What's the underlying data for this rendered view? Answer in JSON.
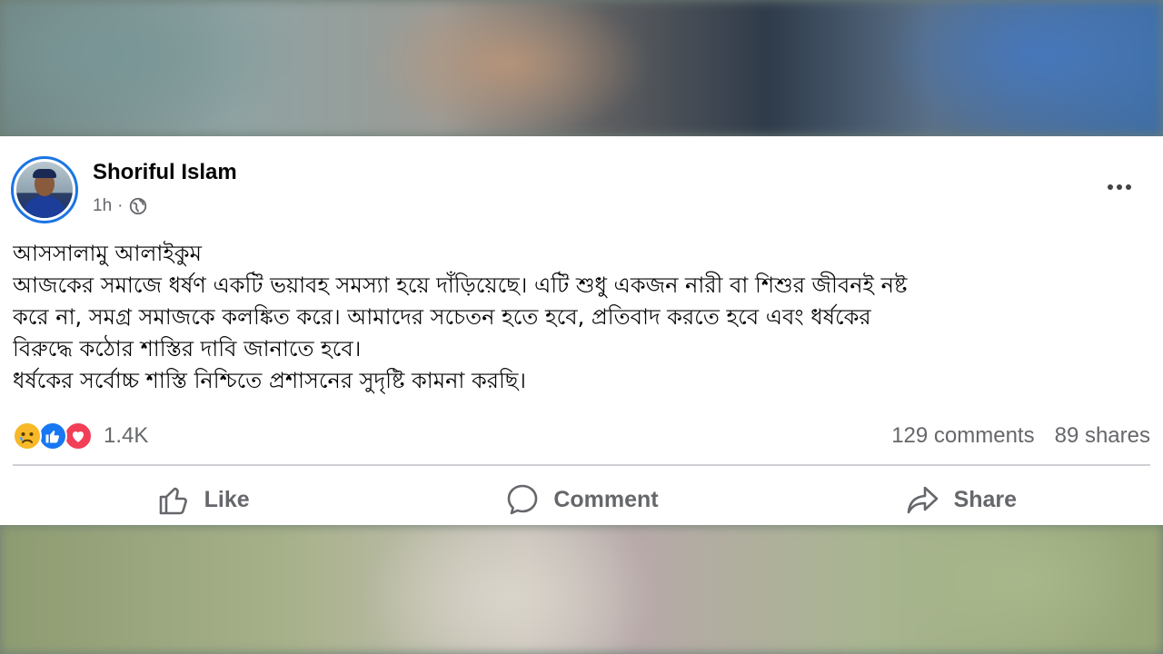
{
  "post": {
    "author": "Shoriful Islam",
    "time": "1h",
    "more_icon": "more-horizontal-icon",
    "privacy_icon": "globe-icon",
    "lines": [
      "আসসালামু আলাইকুম",
      "আজকের সমাজে ধর্ষণ একটি ভয়াবহ সমস্যা হয়ে দাঁড়িয়েছে। এটি শুধু একজন নারী বা শিশুর জীবনই নষ্ট",
      "করে না, সমগ্র সমাজকে কলঙ্কিত করে। আমাদের সচেতন হতে হবে, প্রতিবাদ করতে হবে এবং ধর্ষকের",
      "বিরুদ্ধে কঠোর শাস্তির দাবি জানাতে হবে।",
      "ধর্ষকের সর্বোচ্চ শাস্তি নিশ্চিতে প্রশাসনের সুদৃষ্টি   কামনা করছি।"
    ]
  },
  "reactions": {
    "icons": [
      "sad-reaction-icon",
      "like-reaction-icon",
      "love-reaction-icon"
    ],
    "count": "1.4K"
  },
  "stats": {
    "comments": "129 comments",
    "shares": "89 shares"
  },
  "actions": {
    "like": "Like",
    "comment": "Comment",
    "share": "Share"
  },
  "colors": {
    "accent": "#1b74e4",
    "text_secondary": "#65676b",
    "like_blue": "#1877f2",
    "love_red": "#f33e58",
    "sad_yellow": "#f7b928"
  }
}
